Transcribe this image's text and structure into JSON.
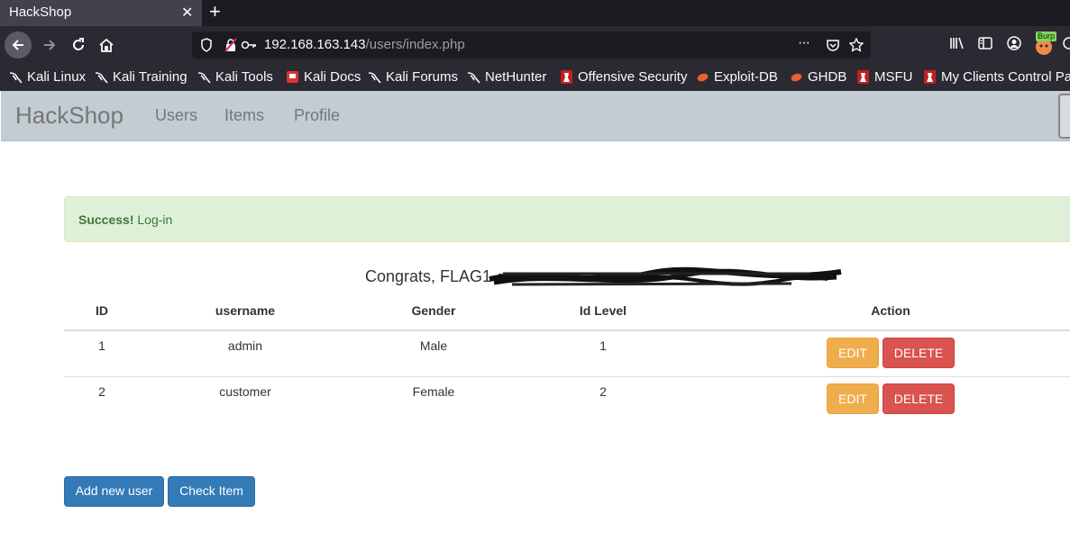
{
  "browser": {
    "tab_title": "HackShop",
    "tab_close": "✕",
    "new_tab": "+",
    "url_host": "192.168.163.143",
    "url_path": "/users/index.php",
    "url_more": "···",
    "burp_label": "Burp",
    "bookmarks": [
      "Kali Linux",
      "Kali Training",
      "Kali Tools",
      "Kali Docs",
      "Kali Forums",
      "NetHunter",
      "Offensive Security",
      "Exploit-DB",
      "GHDB",
      "MSFU",
      "My Clients Control Pa"
    ]
  },
  "site": {
    "brand": "HackShop",
    "nav": [
      "Users",
      "Items",
      "Profile"
    ]
  },
  "alert": {
    "strong": "Success!",
    "text": " Log-in"
  },
  "congrats": "Congrats, FLAG1",
  "table": {
    "headers": [
      "ID",
      "username",
      "Gender",
      "Id Level",
      "Action"
    ],
    "rows": [
      {
        "id": "1",
        "username": "admin",
        "gender": "Male",
        "level": "1"
      },
      {
        "id": "2",
        "username": "customer",
        "gender": "Female",
        "level": "2"
      }
    ],
    "edit_label": "EDIT",
    "delete_label": "DELETE"
  },
  "buttons": {
    "add_user": "Add new user",
    "check_item": "Check Item"
  },
  "colors": {
    "success_bg": "#dff0d8",
    "warning": "#f0ad4e",
    "danger": "#d9534f",
    "primary": "#337ab7",
    "navbar": "#c2ccd2"
  }
}
